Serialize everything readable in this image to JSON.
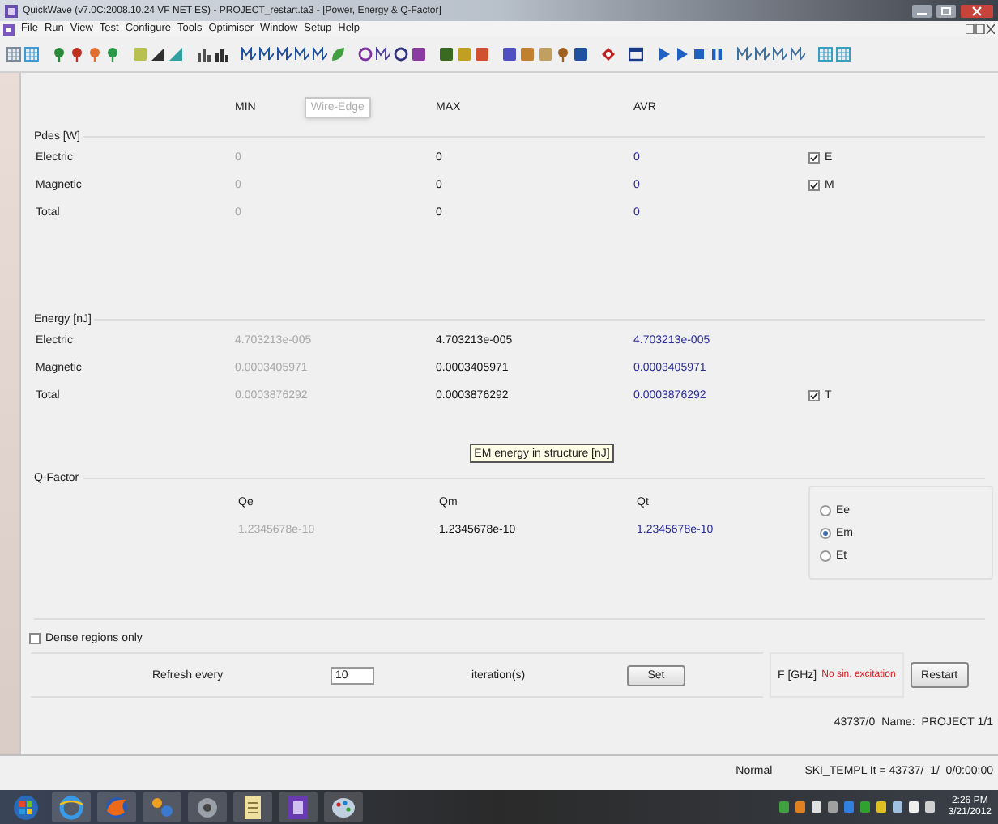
{
  "window": {
    "title": "QuickWave (v7.0C:2008.10.24 VF NET ES) - PROJECT_restart.ta3 - [Power, Energy & Q-Factor]"
  },
  "menu": [
    "File",
    "Run",
    "View",
    "Test",
    "Configure",
    "Tools",
    "Optimiser",
    "Window",
    "Setup",
    "Help"
  ],
  "columns": [
    "MIN",
    "MAX",
    "AVR"
  ],
  "wire_edge_tooltip": "Wire-Edge",
  "pdes": {
    "title": "Pdes [W]",
    "rows": [
      {
        "label": "Electric",
        "min": "0",
        "max": "0",
        "avr": "0",
        "checkbox": {
          "label": "E",
          "checked": true
        }
      },
      {
        "label": "Magnetic",
        "min": "0",
        "max": "0",
        "avr": "0",
        "checkbox": {
          "label": "M",
          "checked": true
        }
      },
      {
        "label": "Total",
        "min": "0",
        "max": "0",
        "avr": "0"
      }
    ]
  },
  "energy": {
    "title": "Energy [nJ]",
    "rows": [
      {
        "label": "Electric",
        "min": "4.703213e-005",
        "max": "4.703213e-005",
        "avr": "4.703213e-005"
      },
      {
        "label": "Magnetic",
        "min": "0.0003405971",
        "max": "0.0003405971",
        "avr": "0.0003405971"
      },
      {
        "label": "Total",
        "min": "0.0003876292",
        "max": "0.0003876292",
        "avr": "0.0003876292",
        "checkbox": {
          "label": "T",
          "checked": true
        }
      }
    ]
  },
  "energy_tooltip": "EM energy in structure [nJ]",
  "q_factor": {
    "title": "Q-Factor",
    "columns": [
      "Qe",
      "Qm",
      "Qt"
    ],
    "values": [
      "1.2345678e-10",
      "1.2345678e-10",
      "1.2345678e-10"
    ],
    "options": [
      {
        "label": "Ee",
        "selected": false
      },
      {
        "label": "Em",
        "selected": true
      },
      {
        "label": "Et",
        "selected": false
      }
    ]
  },
  "dense_regions": {
    "label": "Dense regions only",
    "checked": false
  },
  "refresh": {
    "label": "Refresh every",
    "value": "10",
    "unit": "iteration(s)",
    "button": "Set"
  },
  "frequency": {
    "label": "F [GHz]",
    "value": "No sin. excitation"
  },
  "restart_button": "Restart",
  "info_line": [
    "43737/0",
    "Name:",
    "PROJECT 1/1"
  ],
  "status_bar": {
    "mode": "Normal",
    "info": "SKI_TEMPL It = 43737/  1/  0/0:00:00"
  },
  "taskbar": {
    "time": "2:26 PM",
    "date": "3/21/2012"
  }
}
